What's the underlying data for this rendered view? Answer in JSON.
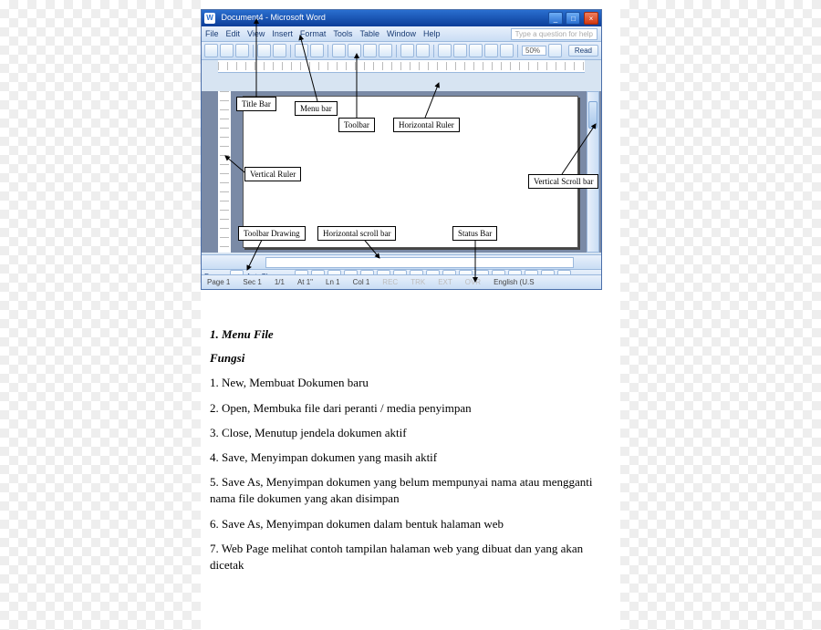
{
  "word": {
    "title_prefix": "W",
    "title": "Document4 - Microsoft Word",
    "menus": [
      "File",
      "Edit",
      "View",
      "Insert",
      "Format",
      "Tools",
      "Table",
      "Window",
      "Help"
    ],
    "help_placeholder": "Type a question for help",
    "zoom": "50%",
    "read_btn": "Read",
    "draw_label": "Draw ▾",
    "autoshapes": "AutoShapes ▾",
    "status": {
      "page": "Page 1",
      "sec": "Sec 1",
      "pages": "1/1",
      "at": "At 1\"",
      "ln": "Ln 1",
      "col": "Col 1",
      "rec": "REC",
      "trk": "TRK",
      "ext": "EXT",
      "ovr": "OVR",
      "lang": "English (U.S"
    }
  },
  "callouts": {
    "title_bar": "Title Bar",
    "menu_bar": "Menu bar",
    "toolbar": "Toolbar",
    "hruler": "Horizontal Ruler",
    "vruler": "Vertical Ruler",
    "vscroll": "Vertical Scroll  bar",
    "toolbar_drawing": "Toolbar Drawing",
    "hscroll": "Horizontal scroll bar",
    "status_bar": "Status Bar"
  },
  "body": {
    "heading": "1. Menu File",
    "subheading": "Fungsi",
    "items": [
      "1. New, Membuat Dokumen baru",
      "2. Open, Membuka file dari peranti / media penyimpan",
      "3. Close, Menutup jendela dokumen aktif",
      "4. Save, Menyimpan dokumen yang masih aktif",
      "5. Save As, Menyimpan dokumen yang belum mempunyai nama atau mengganti nama file dokumen yang akan disimpan",
      "6. Save As, Menyimpan dokumen dalam bentuk halaman web",
      "7. Web Page melihat contoh tampilan halaman web yang dibuat dan yang akan dicetak"
    ]
  }
}
